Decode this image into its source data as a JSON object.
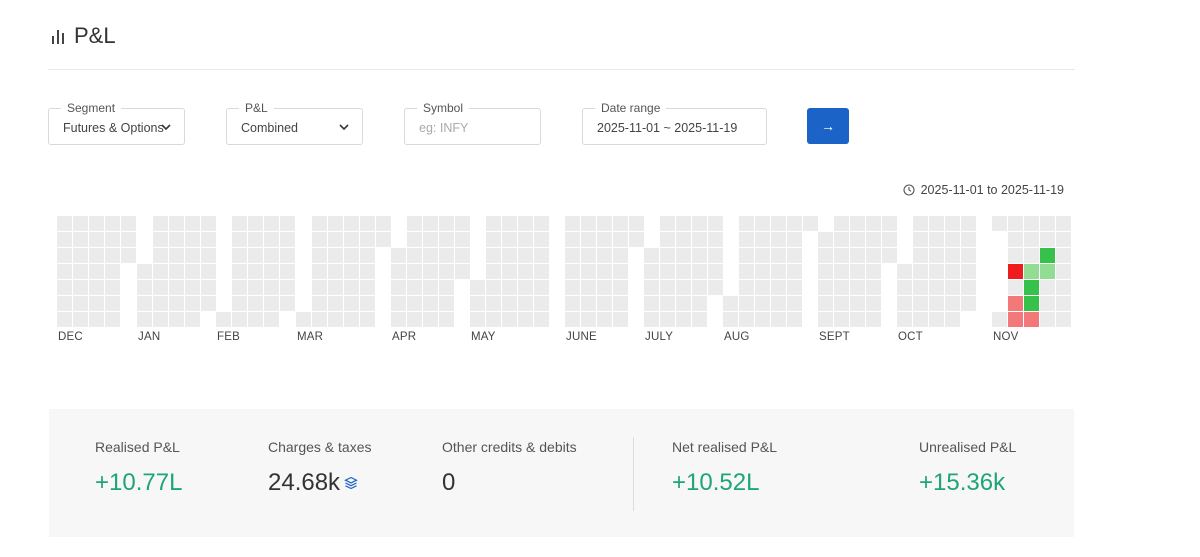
{
  "header": {
    "title": "P&L",
    "icon": "bar-chart-icon"
  },
  "filters": {
    "segment": {
      "label": "Segment",
      "value": "Futures & Options"
    },
    "pnl": {
      "label": "P&L",
      "value": "Combined"
    },
    "symbol": {
      "label": "Symbol",
      "placeholder": "eg: INFY"
    },
    "date_range": {
      "label": "Date range",
      "value": "2025-11-01 ~ 2025-11-19"
    },
    "submit_icon": "→"
  },
  "range_label": "2025-11-01 to 2025-11-19",
  "heatmap": {
    "months": [
      "DEC",
      "JAN",
      "FEB",
      "MAR",
      "APR",
      "MAY",
      "JUNE",
      "JULY",
      "AUG",
      "SEPT",
      "OCT",
      "NOV"
    ],
    "colors": {
      "empty": "#ebebeb",
      "loss": "#ee1c1c",
      "loss_light": "#f2787a",
      "gain": "#36c14a",
      "gain_light": "#93dc94"
    },
    "nov_days": [
      {
        "week": 1,
        "day": 3,
        "level": "loss"
      },
      {
        "week": 2,
        "day": 3,
        "level": "gain_light"
      },
      {
        "week": 3,
        "day": 2,
        "level": "gain"
      },
      {
        "week": 3,
        "day": 3,
        "level": "gain_light"
      },
      {
        "week": 2,
        "day": 4,
        "level": "gain"
      },
      {
        "week": 1,
        "day": 5,
        "level": "loss_light"
      },
      {
        "week": 2,
        "day": 5,
        "level": "gain"
      },
      {
        "week": 1,
        "day": 6,
        "level": "loss_light"
      },
      {
        "week": 2,
        "day": 6,
        "level": "loss_light"
      }
    ]
  },
  "summary": {
    "realised": {
      "label": "Realised P&L",
      "value": "+10.77L"
    },
    "charges": {
      "label": "Charges & taxes",
      "value": "24.68k",
      "icon": "layers-icon"
    },
    "other": {
      "label": "Other credits & debits",
      "value": "0"
    },
    "net": {
      "label": "Net realised P&L",
      "value": "+10.52L"
    },
    "unrealised": {
      "label": "Unrealised P&L",
      "value": "+15.36k"
    }
  }
}
